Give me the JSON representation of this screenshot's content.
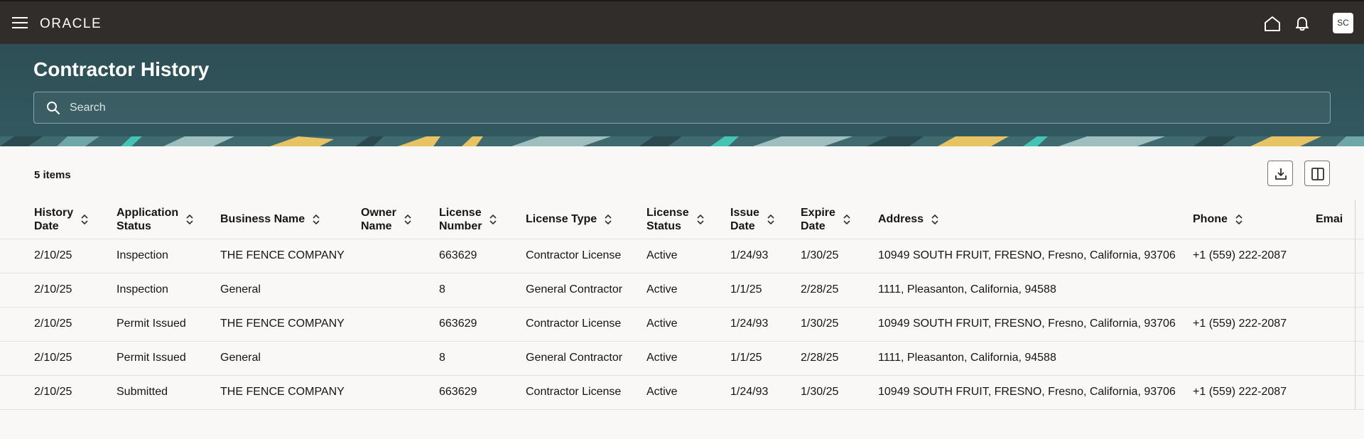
{
  "header": {
    "brand": "ORACLE",
    "avatar_initials": "SC"
  },
  "page": {
    "title": "Contractor History",
    "search_placeholder": "Search"
  },
  "toolbar": {
    "items_count": "5 items"
  },
  "table": {
    "columns": [
      {
        "line1": "History",
        "line2": "Date"
      },
      {
        "line1": "Application",
        "line2": "Status"
      },
      {
        "line1": "Business Name",
        "line2": ""
      },
      {
        "line1": "Owner",
        "line2": "Name"
      },
      {
        "line1": "License",
        "line2": "Number"
      },
      {
        "line1": "License Type",
        "line2": ""
      },
      {
        "line1": "License",
        "line2": "Status"
      },
      {
        "line1": "Issue",
        "line2": "Date"
      },
      {
        "line1": "Expire",
        "line2": "Date"
      },
      {
        "line1": "Address",
        "line2": ""
      },
      {
        "line1": "Phone",
        "line2": ""
      },
      {
        "line1": "Emai",
        "line2": ""
      }
    ],
    "rows": [
      [
        "2/10/25",
        "Inspection",
        "THE FENCE COMPANY",
        "",
        "663629",
        "Contractor License",
        "Active",
        "1/24/93",
        "1/30/25",
        "10949 SOUTH FRUIT, FRESNO, Fresno, California, 93706",
        "+1 (559) 222-2087",
        ""
      ],
      [
        "2/10/25",
        "Inspection",
        "General",
        "",
        "8",
        "General Contractor",
        "Active",
        "1/1/25",
        "2/28/25",
        "1111, Pleasanton, California, 94588",
        "",
        ""
      ],
      [
        "2/10/25",
        "Permit Issued",
        "THE FENCE COMPANY",
        "",
        "663629",
        "Contractor License",
        "Active",
        "1/24/93",
        "1/30/25",
        "10949 SOUTH FRUIT, FRESNO, Fresno, California, 93706",
        "+1 (559) 222-2087",
        ""
      ],
      [
        "2/10/25",
        "Permit Issued",
        "General",
        "",
        "8",
        "General Contractor",
        "Active",
        "1/1/25",
        "2/28/25",
        "1111, Pleasanton, California, 94588",
        "",
        ""
      ],
      [
        "2/10/25",
        "Submitted",
        "THE FENCE COMPANY",
        "",
        "663629",
        "Contractor License",
        "Active",
        "1/24/93",
        "1/30/25",
        "10949 SOUTH FRUIT, FRESNO, Fresno, California, 93706",
        "+1 (559) 222-2087",
        ""
      ]
    ]
  }
}
